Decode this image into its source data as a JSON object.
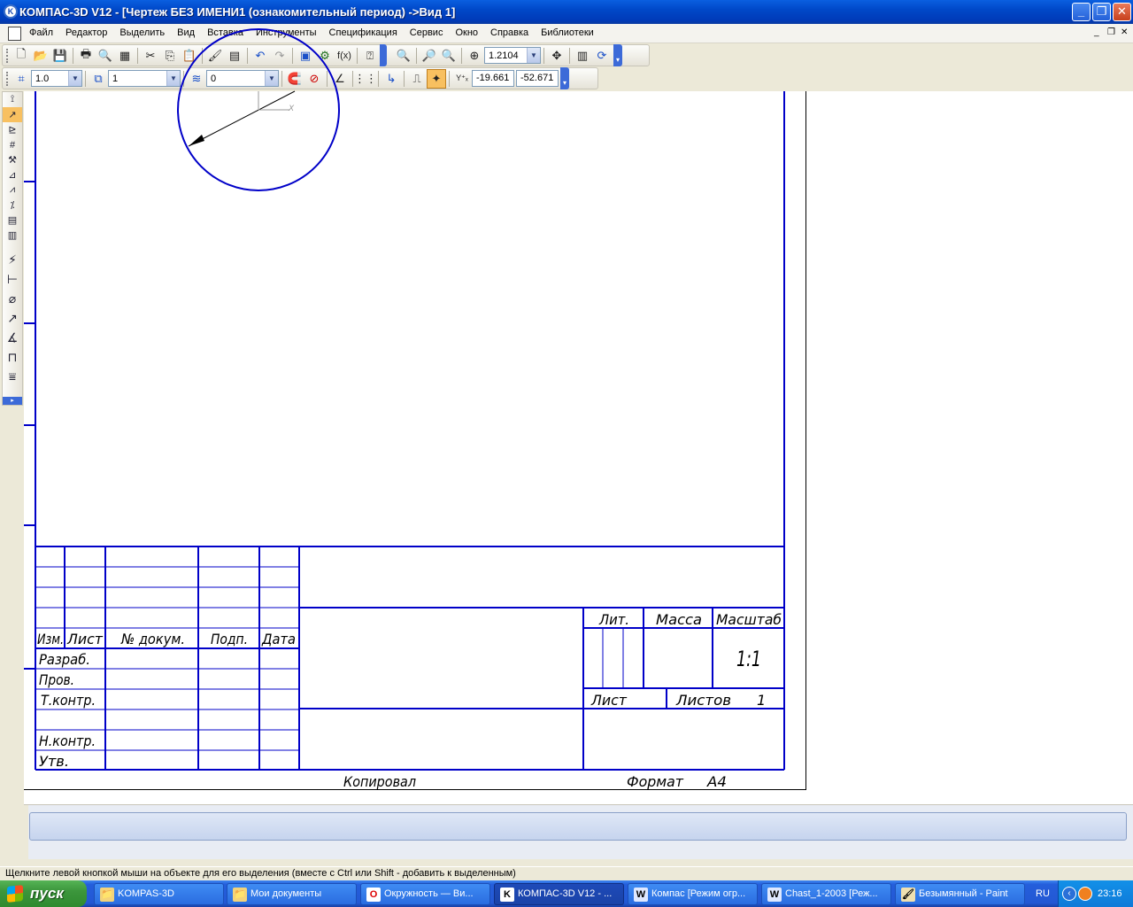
{
  "window": {
    "app_icon": "kompas-logo-icon",
    "title": "КОМПАС-3D V12 - [Чертеж БЕЗ ИМЕНИ1 (ознакомительный период) ->Вид 1]",
    "minimize": "_",
    "maximize": "❐",
    "close": "✕"
  },
  "menu": {
    "items": [
      "Файл",
      "Редактор",
      "Выделить",
      "Вид",
      "Вставка",
      "Инструменты",
      "Спецификация",
      "Сервис",
      "Окно",
      "Справка",
      "Библиотеки"
    ],
    "mdi_min": "_",
    "mdi_restore": "❐",
    "mdi_close": "✕"
  },
  "toolbar_standard": {
    "zoom_value": "1.2104"
  },
  "toolbar_current": {
    "step_value": "1.0",
    "layer_value": "1",
    "style_value": "0",
    "coord_x": "-19.661",
    "coord_y": "-52.671"
  },
  "title_block": {
    "izm": "Изм.",
    "list": "Лист",
    "doc_no": "№ докум.",
    "podp": "Подп.",
    "data": "Дата",
    "razrab": "Разраб.",
    "prov": "Пров.",
    "tkontr": "Т.контр.",
    "nkontr": "Н.контр.",
    "utv": "Утв.",
    "lit": "Лит.",
    "massa": "Масса",
    "masshtab": "Масштаб",
    "scale_value": "1:1",
    "sheet": "Лист",
    "sheets": "Листов",
    "sheets_value": "1",
    "copied": "Копировал",
    "format": "Формат",
    "format_value": "A4",
    "axis_x": "X"
  },
  "status": {
    "hint": "Щелкните левой кнопкой мыши на объекте для его выделения (вместе с Ctrl или Shift - добавить к выделенным)"
  },
  "taskbar": {
    "start": "пуск",
    "tasks": [
      {
        "label": "KOMPAS-3D",
        "icon": "folder-icon"
      },
      {
        "label": "Мои документы",
        "icon": "folder-icon"
      },
      {
        "label": "Окружность — Ви...",
        "icon": "opera-icon"
      },
      {
        "label": "КОМПАС-3D V12 - ...",
        "icon": "kompas-icon"
      },
      {
        "label": "Компас [Режим огр...",
        "icon": "word-icon"
      },
      {
        "label": "Chast_1-2003 [Реж...",
        "icon": "word-icon"
      },
      {
        "label": "Безымянный - Paint",
        "icon": "paint-icon"
      }
    ],
    "lang": "RU",
    "clock": "23:16"
  },
  "colors": {
    "drawing_line": "#0000c8",
    "titlebar": "#0054e3",
    "taskbar": "#245edb",
    "start": "#3c963c"
  }
}
